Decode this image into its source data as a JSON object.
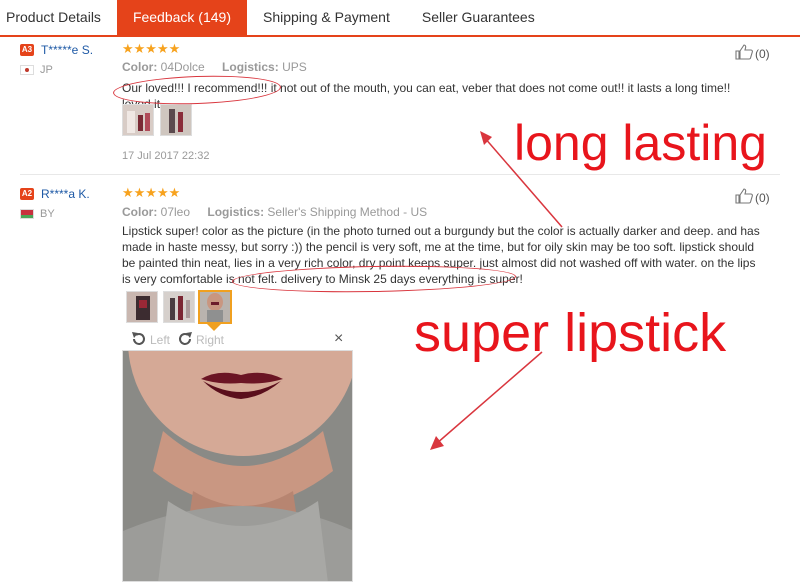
{
  "tabs": [
    {
      "label": "Product Details"
    },
    {
      "label": "Feedback (149)"
    },
    {
      "label": "Shipping & Payment"
    },
    {
      "label": "Seller Guarantees"
    }
  ],
  "reviews": [
    {
      "badge": "A3",
      "user": "T*****e S.",
      "country": "JP",
      "stars": "★★★★★",
      "color_label": "Color:",
      "color": "04Dolce",
      "logistics_label": "Logistics:",
      "logistics": "UPS",
      "text": "Our loved!!! I recommend!!! it not out of the mouth, you can eat, veber that does not come out!! it lasts a long time!! loved it",
      "date": "17 Jul 2017 22:32",
      "helpful": "(0)"
    },
    {
      "badge": "A2",
      "user": "R****a K.",
      "country": "BY",
      "stars": "★★★★★",
      "color_label": "Color:",
      "color": "07leo",
      "logistics_label": "Logistics:",
      "logistics": "Seller's Shipping Method - US",
      "text": "Lipstick super! color as the picture (in the photo turned out a burgundy but the color is actually darker and deep. and has made in haste messy, but sorry :)) the pencil is very soft, me at the time, but for oily skin may be too soft. lipstick should be painted thin neat, lies in a very rich color, dry point keeps super. just almost did not washed off with water. on the lips is very comfortable is not felt. delivery to Minsk 25 days everything is super!",
      "helpful": "(0)"
    }
  ],
  "viewer": {
    "left": "Left",
    "right": "Right",
    "close": "×"
  },
  "annotations": {
    "long_lasting": "long lasting",
    "super_lipstick": "super lipstick"
  },
  "colors": {
    "accent": "#e5431a",
    "star": "#f7a21e",
    "annotation": "#e8151c"
  }
}
